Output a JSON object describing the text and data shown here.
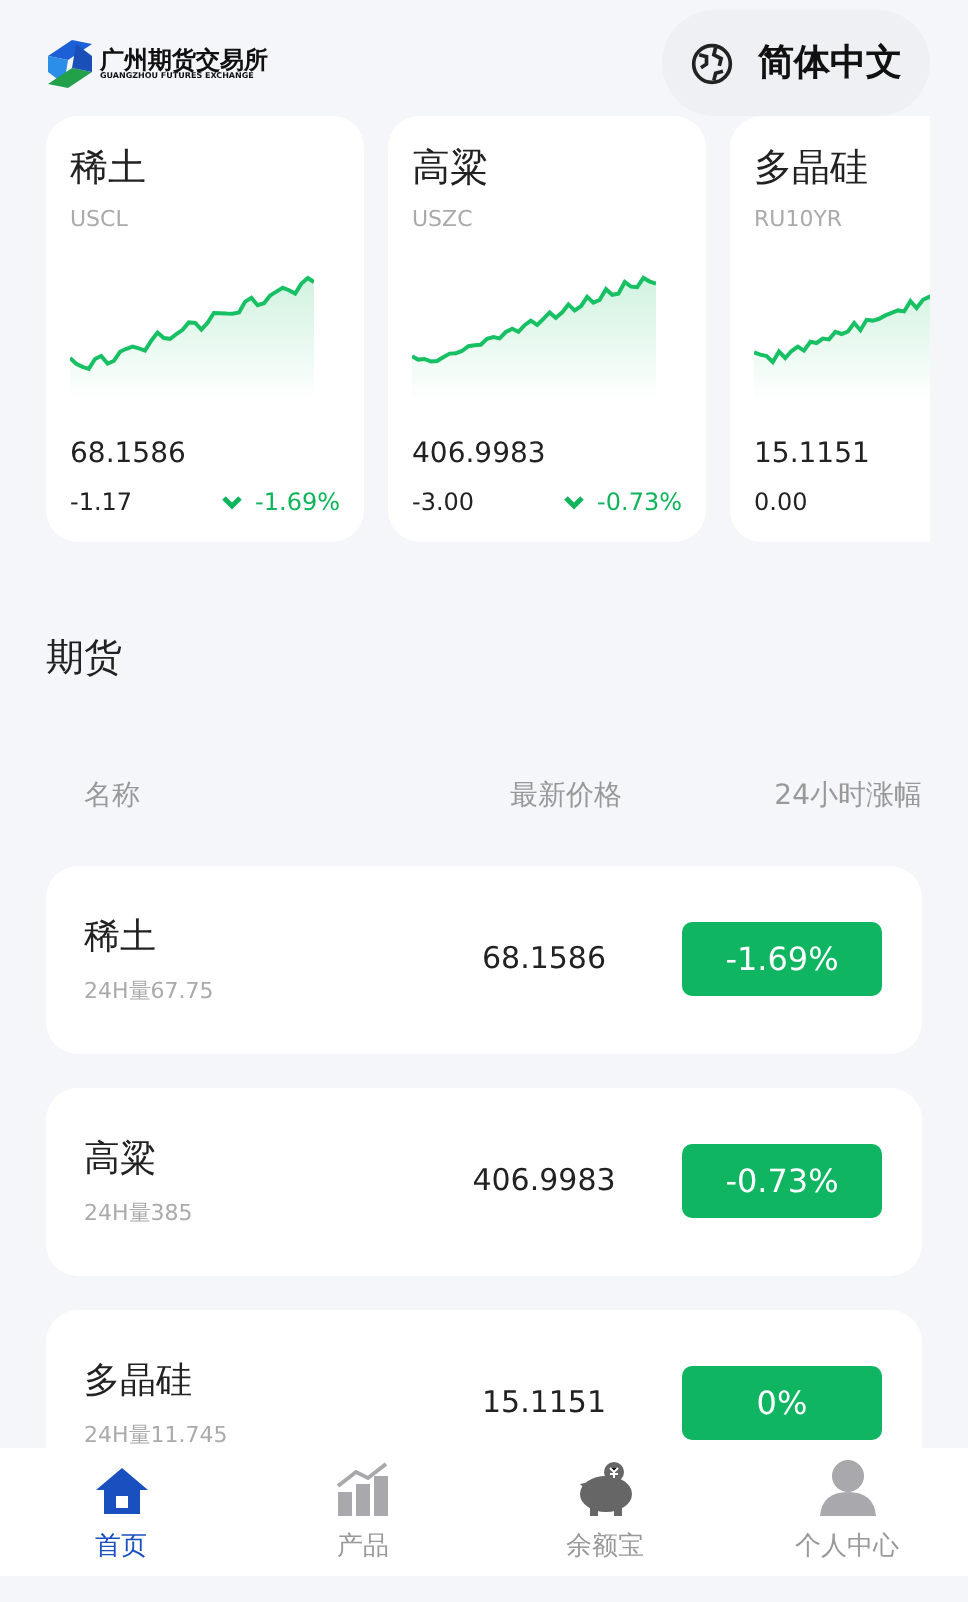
{
  "header": {
    "logo_title": "广州期货交易所",
    "logo_subtitle": "GUANGZHOU FUTURES EXCHANGE",
    "language": "简体中文"
  },
  "cards": [
    {
      "name": "稀土",
      "code": "USCL",
      "price": "68.1586",
      "change": "-1.17",
      "percent": "-1.69%",
      "falling": true
    },
    {
      "name": "高粱",
      "code": "USZC",
      "price": "406.9983",
      "change": "-3.00",
      "percent": "-0.73%",
      "falling": true
    },
    {
      "name": "多晶硅",
      "code": "RU10YR",
      "price": "15.1151",
      "change": "0.00"
    }
  ],
  "section_title": "期货",
  "table": {
    "columns": [
      "名称",
      "最新价格",
      "24小时涨幅"
    ],
    "rows": [
      {
        "name": "稀土",
        "volume": "24H量67.75",
        "price": "68.1586",
        "change": "-1.69%"
      },
      {
        "name": "高粱",
        "volume": "24H量385",
        "price": "406.9983",
        "change": "-0.73%"
      },
      {
        "name": "多晶硅",
        "volume": "24H量11.745",
        "price": "15.1151",
        "change": "0%"
      }
    ]
  },
  "nav": [
    {
      "label": "首页",
      "selected": true
    },
    {
      "label": "产品",
      "selected": false
    },
    {
      "label": "余额宝",
      "selected": false
    },
    {
      "label": "个人中心",
      "selected": false
    }
  ]
}
